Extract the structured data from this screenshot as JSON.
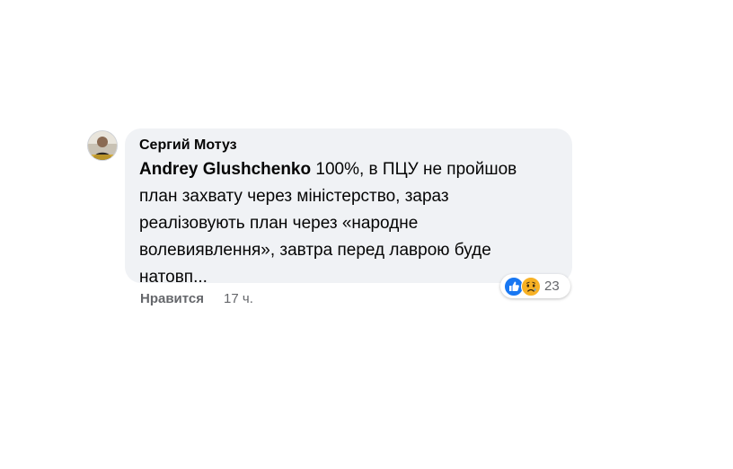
{
  "comment": {
    "author": "Сергий Мотуз",
    "mention": "Andrey Glushchenko",
    "text": " 100%, в ПЦУ не пройшов план захвату через міністерство, зараз реалізовують план через «народне волевиявлення», завтра перед лаврою буде натовп..."
  },
  "reactions": {
    "icons": [
      "like-icon",
      "sad-icon"
    ],
    "count": "23",
    "like_color": "#1877f2",
    "sad_color": "#f7b125"
  },
  "actions": {
    "like_label": "Нравится",
    "timestamp": "17 ч."
  }
}
